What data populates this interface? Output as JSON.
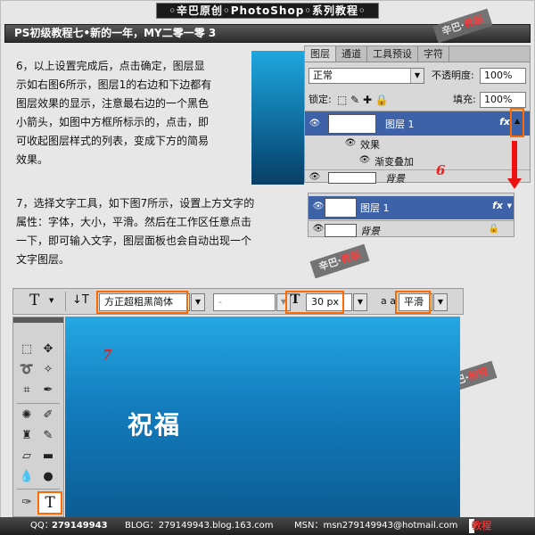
{
  "banner": {
    "text": "◦辛巴原创◦PhotoShop◦系列教程◦"
  },
  "title": "PS初级教程七•新的一年，MY二零一零 3",
  "watermark": {
    "part1": "辛巴",
    "part2": "教程"
  },
  "step6": {
    "lines": [
      "6，以上设置完成后，点击确定，图层显",
      "示如右图6所示，图层1的右边和下边都有",
      "图层效果的显示，注意最右边的一个黑色",
      "小箭头，如图中方框所标示的，点击，即",
      "可收起图层样式的列表，变成下方的简易",
      "效果。"
    ]
  },
  "step7": {
    "lines": [
      "7，选择文字工具，如下图7所示，设置上方文字的",
      "属性：字体，大小，平滑。然后在工作区任意点击",
      "一下，即可输入文字，图层面板也会自动出现一个",
      "文字图层。"
    ]
  },
  "layers_panel": {
    "tabs": [
      "图层",
      "通道",
      "工具预设",
      "字符"
    ],
    "blend_mode": "正常",
    "opacity_label": "不透明度:",
    "opacity_value": "100%",
    "lock_label": "锁定:",
    "fill_label": "填充:",
    "fill_value": "100%",
    "layer1_name": "图层 1",
    "fx_label": "fx",
    "effects_label": "效果",
    "gradient_overlay_label": "渐变叠加",
    "background_name": "背景",
    "marker": "6"
  },
  "layers_panel_2": {
    "layer1_name": "图层 1",
    "fx_label": "fx",
    "background_name": "背景"
  },
  "options_bar": {
    "tool_glyph": "T",
    "font_family": "方正超粗黑简体",
    "font_style": "-",
    "font_size_icon": "T",
    "font_size": "30 px",
    "aa_icon": "a a",
    "antialias": "平滑"
  },
  "canvas": {
    "text": "祝福",
    "marker": "7"
  },
  "footer": {
    "qq_label": "QQ：",
    "qq": "279149943",
    "blog": "BLOG：279149943.blog.163.com",
    "msn": "MSN：msn279149943@hotmail.com",
    "logo1": "辛巴",
    "logo2": "教程"
  }
}
